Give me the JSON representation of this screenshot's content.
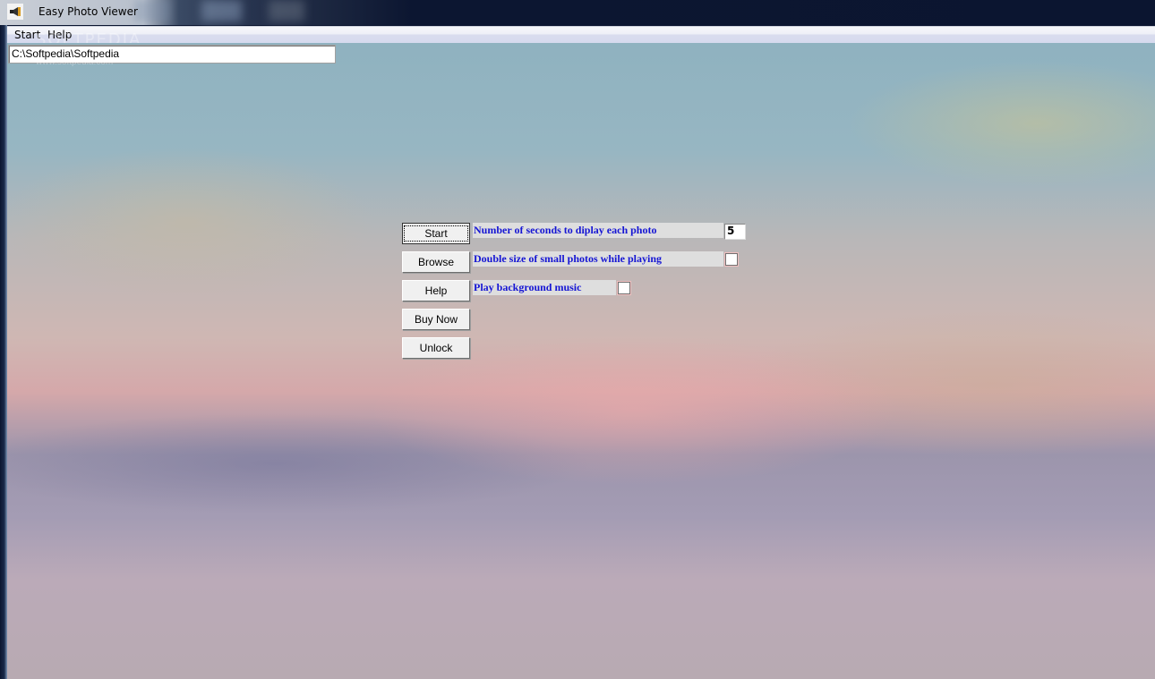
{
  "window": {
    "title": "Easy Photo Viewer",
    "icon": "speaker-icon"
  },
  "menu": {
    "items": [
      {
        "label": "Start"
      },
      {
        "label": "Help"
      }
    ]
  },
  "watermark": {
    "brand": "SOFTPEDIA",
    "url": "www.softpedia.com"
  },
  "path_field": {
    "value": "C:\\Softpedia\\Softpedia"
  },
  "buttons": [
    {
      "label": "Start",
      "default": true
    },
    {
      "label": "Browse"
    },
    {
      "label": "Help"
    },
    {
      "label": "Buy Now"
    },
    {
      "label": "Unlock"
    }
  ],
  "options": {
    "seconds": {
      "label": "Number of seconds to diplay each photo",
      "value": "5"
    },
    "double_size": {
      "label": "Double size of small photos while playing",
      "checked": false
    },
    "music": {
      "label": "Play background music",
      "checked": false
    }
  },
  "colors": {
    "label_text": "#1515d4",
    "label_bg": "#dedede",
    "titlebar": "#0b1530"
  }
}
